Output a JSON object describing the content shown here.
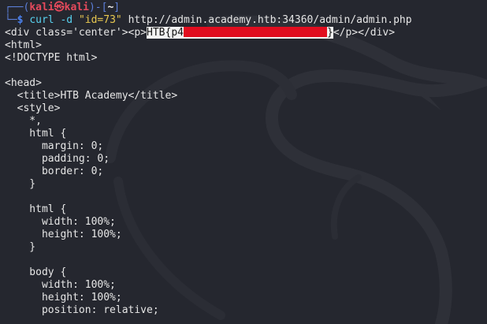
{
  "prompt": {
    "top_prefix": "┌──(",
    "user": "kali",
    "at_glyph": "㉿",
    "host": "kali",
    "mid": ")-[",
    "dir": "~",
    "close": "]",
    "bottom_prefix": "└─",
    "symbol": "$"
  },
  "command": {
    "name": "curl",
    "flag": "-d",
    "data": "\"id=73\"",
    "url": "http://admin.academy.htb:34360/admin/admin.php"
  },
  "output": {
    "first_before": "<div class='center'><p>",
    "flag_prefix": "HTB{p4",
    "flag_close": "}",
    "first_after": "</p></div>",
    "lines": [
      "<html>",
      "<!DOCTYPE html>",
      "",
      "<head>",
      "  <title>HTB Academy</title>",
      "  <style>",
      "    *,",
      "    html {",
      "      margin: 0;",
      "      padding: 0;",
      "      border: 0;",
      "    }",
      "",
      "    html {",
      "      width: 100%;",
      "      height: 100%;",
      "    }",
      "",
      "    body {",
      "      width: 100%;",
      "      height: 100%;",
      "      position: relative;"
    ]
  }
}
